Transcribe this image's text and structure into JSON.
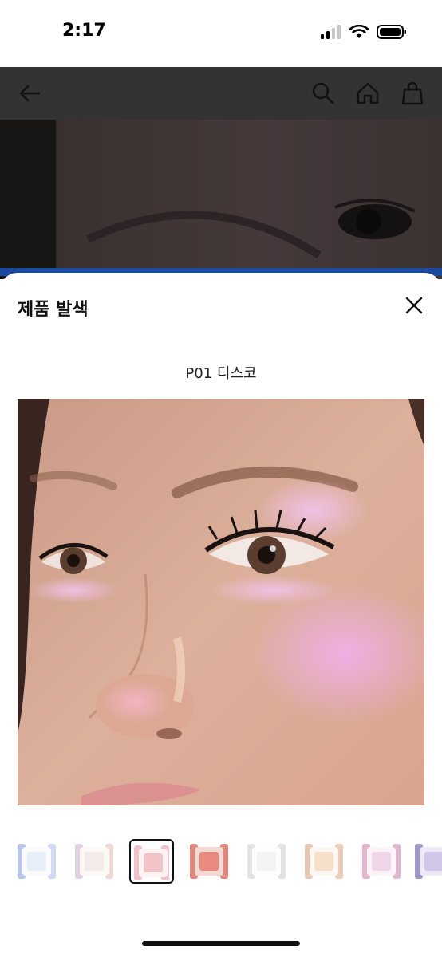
{
  "status_bar": {
    "time": "2:17"
  },
  "app_bar": {
    "icons": [
      "back-arrow-icon",
      "search-icon",
      "home-icon",
      "shopping-bag-icon"
    ]
  },
  "sheet": {
    "title": "제품 발색",
    "shade_name": "P01 디스코"
  },
  "thumbnails": {
    "count": 8,
    "selected_index": 2,
    "colors": [
      "#e8eef8",
      "#f3eaea",
      "#f2c4c7",
      "#e88a7e",
      "#f3f3f3",
      "#f6e0c9",
      "#eed6e8",
      "#d2c6e8"
    ]
  },
  "colors": {
    "app_bar_dimmed": "#333333",
    "sheet_bg": "#ffffff",
    "selected_border": "#111111"
  }
}
